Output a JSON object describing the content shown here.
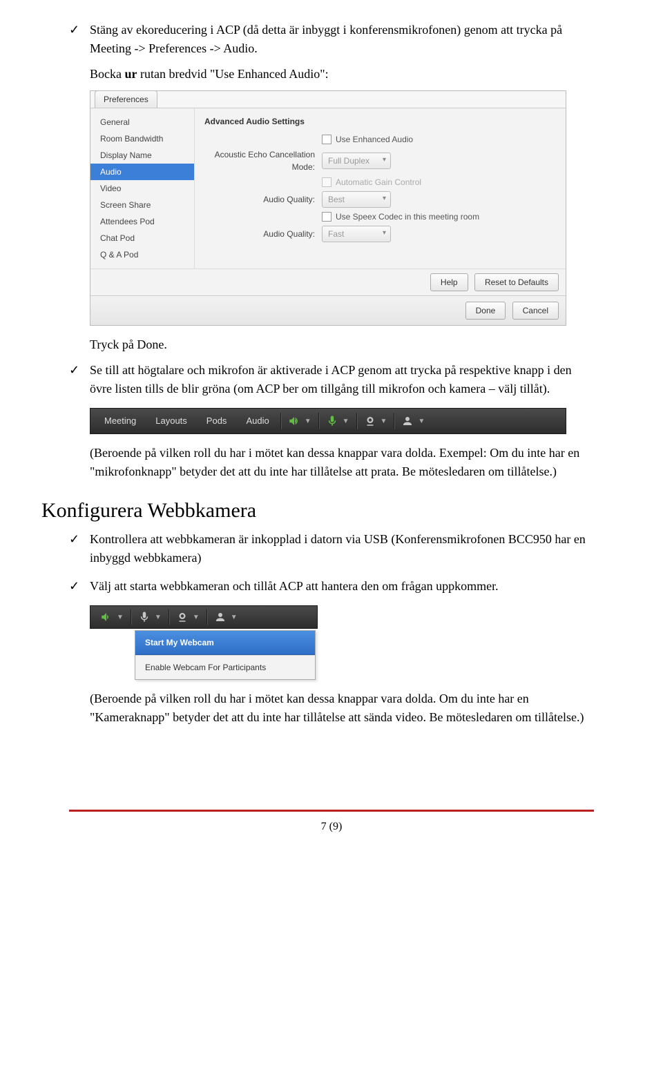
{
  "doc": {
    "bullet1_a": "Stäng av ekoreducering i ACP (då detta är inbyggt i konferensmikrofonen) genom att trycka på Meeting -> Preferences -> Audio.",
    "indent1_prefix": "Bocka ",
    "indent1_bold": "ur",
    "indent1_suffix": " rutan bredvid \"Use Enhanced Audio\":",
    "indent2": "Tryck på Done.",
    "bullet2": "Se till att högtalare och mikrofon är aktiverade i ACP genom att trycka på respektive knapp i den övre listen tills de blir gröna (om ACP ber om tillgång till mikrofon och kamera – välj tillåt).",
    "indent3": "(Beroende på vilken roll du har i mötet kan dessa knappar vara dolda. Exempel: Om du inte har en \"mikrofonknapp\" betyder det att du inte har tillåtelse att prata. Be mötesledaren om tillåtelse.)",
    "heading_webcam": "Konfigurera Webbkamera",
    "bullet3": "Kontrollera att webbkameran är inkopplad i datorn via USB (Konferensmikrofonen BCC950 har en inbyggd webbkamera)",
    "bullet4": "Välj att starta webbkameran och tillåt ACP att hantera den om frågan uppkommer.",
    "indent4": "(Beroende på vilken roll du har i mötet kan dessa knappar vara dolda. Om du inte har en \"Kameraknapp\" betyder det att du inte har tillåtelse att sända video. Be mötesledaren om tillåtelse.)",
    "page_num": "7 (9)"
  },
  "prefs": {
    "tab": "Preferences",
    "sidebar": [
      "General",
      "Room Bandwidth",
      "Display Name",
      "Audio",
      "Video",
      "Screen Share",
      "Attendees Pod",
      "Chat Pod",
      "Q & A Pod"
    ],
    "selected_index": 3,
    "section_title": "Advanced Audio Settings",
    "row_enhanced": "Use Enhanced Audio",
    "row_echo_label": "Acoustic Echo Cancellation Mode:",
    "row_echo_val": "Full Duplex",
    "row_gain": "Automatic Gain Control",
    "row_quality1_label": "Audio Quality:",
    "row_quality1_val": "Best",
    "row_speex": "Use Speex Codec in this meeting room",
    "row_quality2_label": "Audio Quality:",
    "row_quality2_val": "Fast",
    "btn_help": "Help",
    "btn_reset": "Reset to Defaults",
    "btn_done": "Done",
    "btn_cancel": "Cancel"
  },
  "toolbar": {
    "items": [
      "Meeting",
      "Layouts",
      "Pods",
      "Audio"
    ]
  },
  "webcam_menu": {
    "start": "Start My Webcam",
    "enable": "Enable Webcam For Participants"
  }
}
